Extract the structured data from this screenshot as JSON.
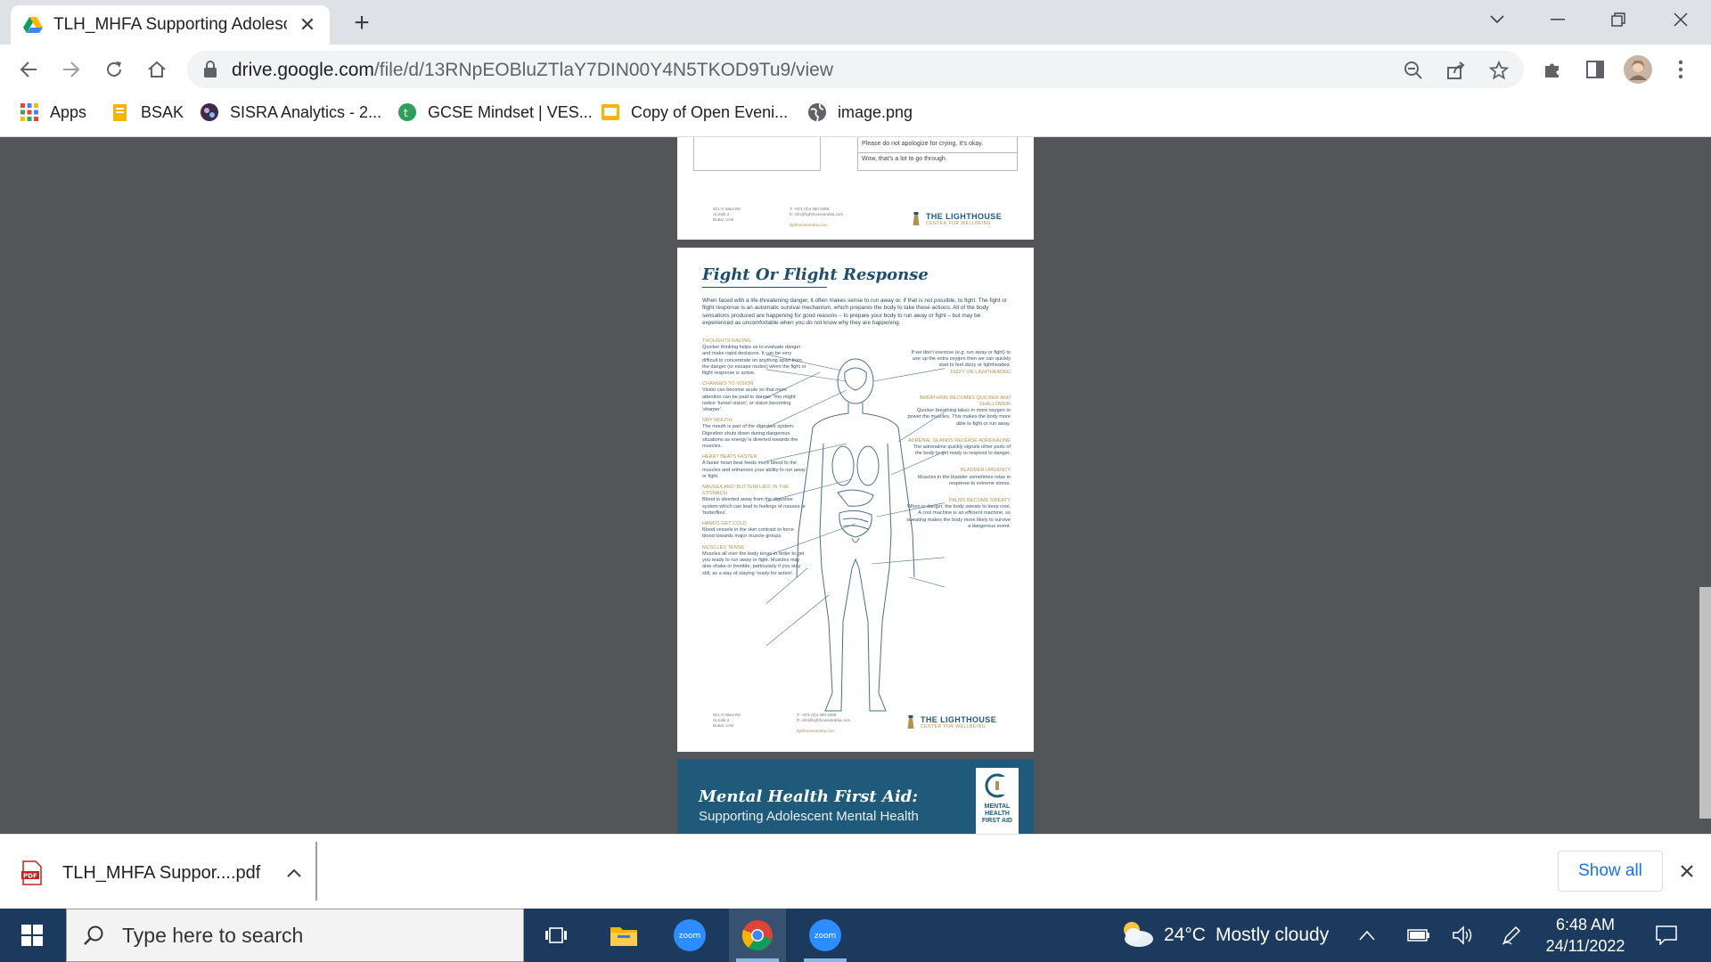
{
  "browser": {
    "tab_title": "TLH_MHFA Supporting Adolescen",
    "url_host": "drive.google.com",
    "url_path": "/file/d/13RNpEOBluZTlaY7DIN00Y4N5TKOD9Tu9/view",
    "bookmarks": [
      {
        "label": "Apps",
        "icon": "apps-grid-icon"
      },
      {
        "label": "BSAK",
        "icon": "bookmark-folder-icon"
      },
      {
        "label": "SISRA Analytics - 2...",
        "icon": "sisra-icon"
      },
      {
        "label": "GCSE Mindset | VES...",
        "icon": "gcse-icon"
      },
      {
        "label": "Copy of Open Eveni...",
        "icon": "slides-icon"
      },
      {
        "label": "image.png",
        "icon": "globe-icon"
      }
    ]
  },
  "document": {
    "page1": {
      "table_rows": [
        "Please do not apologize for crying. It's okay.",
        "Wow, that's a lot to go through."
      ],
      "footer_addr": [
        "821 Al Wasl Rd",
        "Al Safa 2",
        "Dubai, UAE"
      ],
      "footer_contact": [
        "T: +971 (0)4 380 2088",
        "E: info@lighthousearabia.com",
        "lighthousearabia.com"
      ],
      "brand": "THE LIGHTHOUSE",
      "brand_sub": "CENTER FOR WELLBEING"
    },
    "page2": {
      "title": "Fight Or Flight Response",
      "intro": "When faced with a life-threatening danger, it often makes sense to run away or, if that is not possible, to fight. The fight or flight response is an automatic survival mechanism, which prepares the body to take these actions. All of the body sensations produced are happening for good reasons – to prepare your body to run away or fight – but may be experienced as uncomfortable when you do not know why they are happening.",
      "left_items": [
        {
          "heading": "THOUGHTS RACING",
          "body": "Quicker thinking helps us to evaluate danger and make rapid decisions. It can be very difficult to concentrate on anything apart from the danger (or escape routes) when the fight or flight response is active."
        },
        {
          "heading": "CHANGES TO VISION",
          "body": "Vision can become acute so that more attention can be paid to danger. You might notice 'tunnel vision', or vision becoming 'sharper'."
        },
        {
          "heading": "DRY MOUTH",
          "body": "The mouth is part of the digestive system. Digestion shuts down during dangerous situations as energy is diverted towards the muscles."
        },
        {
          "heading": "HEART BEATS FASTER",
          "body": "A faster heart beat feeds more blood to the muscles and enhances your ability to run away or fight."
        },
        {
          "heading": "NAUSEA AND 'BUTTERFLIES' IN THE STOMACH",
          "body": "Blood is diverted away from the digestive system which can lead to feelings of nausea or 'butterflies'."
        },
        {
          "heading": "HANDS GET COLD",
          "body": "Blood vessels in the skin contract to force blood towards major muscle groups."
        },
        {
          "heading": "MUSCLES TENSE",
          "body": "Muscles all over the body tense in order to get you ready to run away or fight. Muscles may also shake or tremble, particularly if you stay still, as a way of staying 'ready for action'."
        }
      ],
      "right_items": [
        {
          "heading": "DIZZY OR LIGHTHEADED",
          "body": "If we don't exercise (e.g. run away or fight) to use up the extra oxygen then we can quickly start to feel dizzy or lightheaded."
        },
        {
          "heading": "BREATHING BECOMES QUICKER AND SHALLOWER",
          "body": "Quicker breathing takes in more oxygen to power the muscles. This makes the body more able to fight or run away."
        },
        {
          "heading": "ADRENAL GLANDS RELEASE ADRENALINE",
          "body": "The adrenaline quickly signals other parts of the body to get ready to respond to danger."
        },
        {
          "heading": "BLADDER URGENCY",
          "body": "Muscles in the bladder sometimes relax in response to extreme stress."
        },
        {
          "heading": "PALMS BECOME SWEATY",
          "body": "When in danger, the body sweats to keep cool. A cool machine is an efficient machine, so sweating makes the body more likely to survive a dangerous event."
        }
      ],
      "footer_addr": [
        "821 Al Wasl Rd",
        "Al Safa 2",
        "Dubai, UAE"
      ],
      "footer_contact": [
        "T: +971 (0)4 380 2088",
        "E: info@lighthousearabia.com",
        "lighthousearabia.com"
      ],
      "brand": "THE LIGHTHOUSE",
      "brand_sub": "CENTER FOR WELLBEING"
    },
    "page3": {
      "title": "Mental Health First Aid:",
      "subtitle": "Supporting Adolescent Mental Health",
      "logo_lines": [
        "MENTAL",
        "HEALTH",
        "FIRST AID"
      ]
    }
  },
  "downloads": {
    "file_name": "TLH_MHFA Suppor....pdf",
    "show_all": "Show all"
  },
  "taskbar": {
    "search_placeholder": "Type here to search",
    "zoom_label": "zoom",
    "weather_temp": "24°C",
    "weather_desc": "Mostly cloudy",
    "time": "6:48 AM",
    "date": "24/11/2022"
  },
  "colors": {
    "viewer_bg": "#525659",
    "taskbar_bg": "#1c3a5e",
    "doc_accent": "#1f5a7a",
    "doc_gold": "#b0934e",
    "link_blue": "#1a73e8"
  }
}
